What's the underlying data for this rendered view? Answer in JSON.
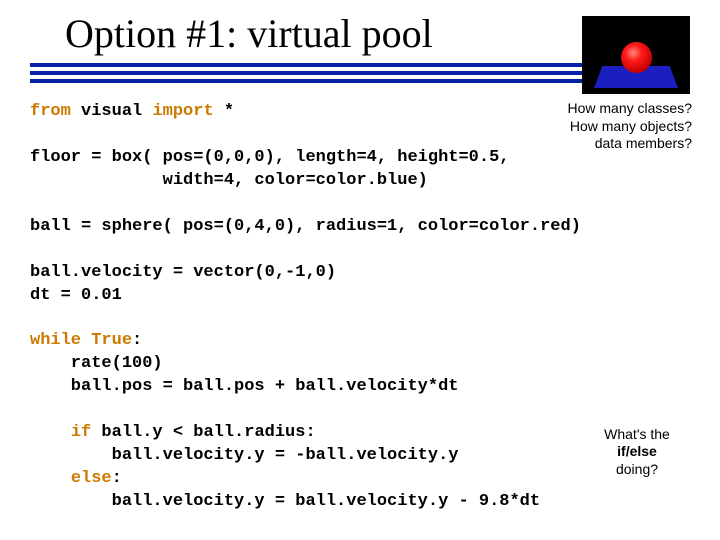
{
  "title": "Option #1:  virtual pool",
  "code": {
    "import_prefix": "from ",
    "import_mid": "visual ",
    "import_kw2": "import ",
    "import_suffix": "*",
    "floor_line1": "floor = box( pos=(0,0,0), length=4, height=0.5,",
    "floor_line2": "             width=4, color=color.blue)",
    "ball_line": "ball = sphere( pos=(0,4,0), radius=1, color=color.red)",
    "vel_line": "ball.velocity = vector(0,-1,0)",
    "dt_line": "dt = 0.01",
    "while_kw": "while ",
    "while_cond": "True",
    "while_colon": ":",
    "rate_line": "    rate(100)",
    "pos_line": "    ball.pos = ball.pos + ball.velocity*dt",
    "if_indent": "    ",
    "if_kw": "if ",
    "if_cond": "ball.y < ball.radius:",
    "if_body": "        ball.velocity.y = -ball.velocity.y",
    "else_indent": "    ",
    "else_kw": "else",
    "else_colon": ":",
    "else_body": "        ball.velocity.y = ball.velocity.y - 9.8*dt"
  },
  "annotations": {
    "top1": "How many classes?",
    "top2": "How many objects?",
    "top3": "data members?",
    "bot1": "What's the",
    "bot2": "if/else",
    "bot3": "doing?"
  },
  "thumbnail": {
    "ball_color": "#ff1a1a",
    "floor_color": "#1b1fbf",
    "bg": "#000000"
  }
}
